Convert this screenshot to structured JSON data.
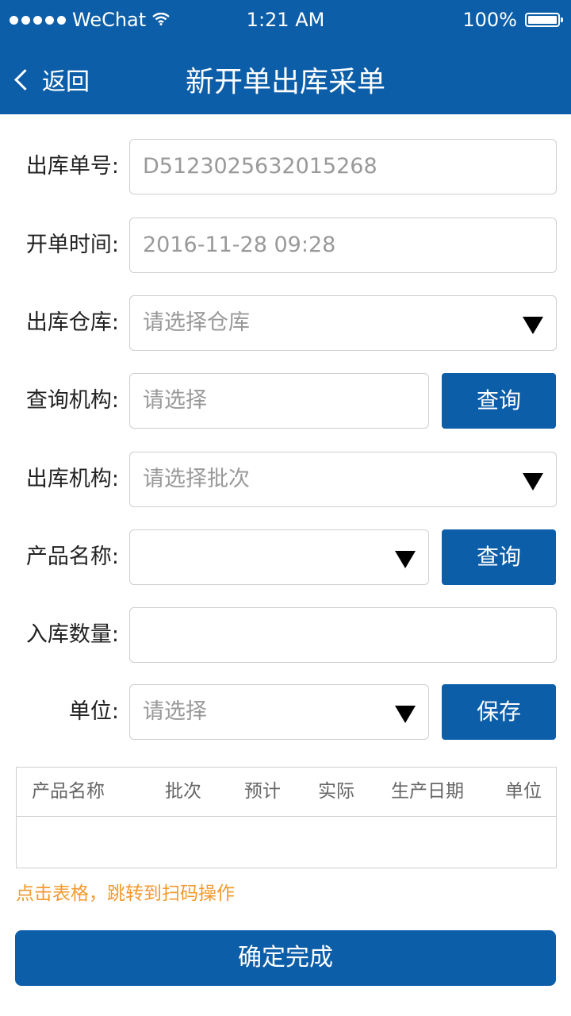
{
  "status_bar": {
    "carrier": "WeChat",
    "time": "1:21 AM",
    "battery": "100%",
    "icons": [
      "signal-dots-icon",
      "wifi-icon",
      "battery-icon"
    ]
  },
  "nav": {
    "back_label": "返回",
    "title": "新开单出库采单"
  },
  "form": {
    "order_no": {
      "label": "出库单号:",
      "value": "D5123025632015268"
    },
    "open_time": {
      "label": "开单时间:",
      "value": "2016-11-28 09:28"
    },
    "warehouse": {
      "label": "出库仓库:",
      "placeholder": "请选择仓库"
    },
    "query_org": {
      "label": "查询机构:",
      "placeholder": "请选择",
      "button": "查询"
    },
    "out_org": {
      "label": "出库机构:",
      "placeholder": "请选择批次"
    },
    "product_name": {
      "label": "产品名称:",
      "value": "",
      "button": "查询"
    },
    "quantity": {
      "label": "入库数量:",
      "value": ""
    },
    "unit": {
      "label": "单位:",
      "placeholder": "请选择",
      "button": "保存"
    }
  },
  "table": {
    "columns": [
      "产品名称",
      "批次",
      "预计",
      "实际",
      "生产日期",
      "单位"
    ],
    "rows": []
  },
  "hint": "点击表格，跳转到扫码操作",
  "confirm_button": "确定完成",
  "colors": {
    "primary": "#0d5ea8",
    "hint": "#f29a2e",
    "border": "#cfcfcf"
  }
}
